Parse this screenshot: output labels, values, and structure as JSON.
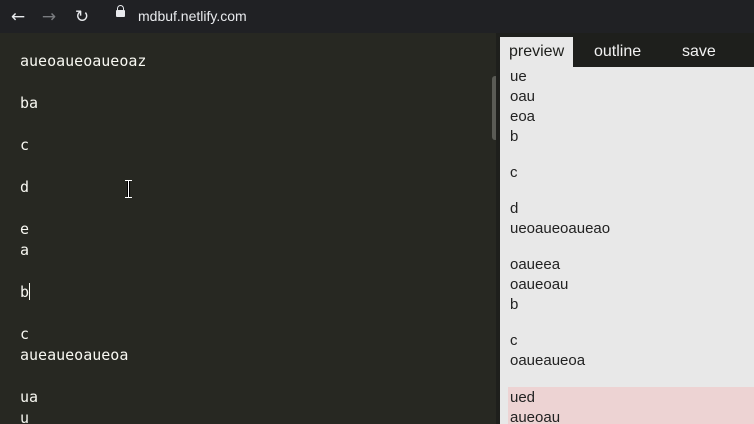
{
  "browser": {
    "url": "mdbuf.netlify.com",
    "icons": {
      "back": "arrow-left-icon",
      "forward": "arrow-right-icon",
      "reload": "reload-icon",
      "secure": "lock-icon"
    }
  },
  "editor": {
    "lines": [
      "aueoaueoaueoaz",
      "",
      "ba",
      "",
      "c",
      "",
      "d",
      "",
      "e",
      "a",
      "",
      "b",
      "",
      "c",
      "aueaueoaueoa",
      "",
      "ua",
      "u"
    ],
    "caret_line_index": 11
  },
  "panel": {
    "tabs": [
      {
        "label": "preview",
        "active": true
      },
      {
        "label": "outline",
        "active": false
      },
      {
        "label": "save",
        "active": false
      }
    ],
    "preview_blocks": [
      {
        "lines": [
          "ue",
          "oau",
          "eoa",
          "b"
        ]
      },
      {
        "lines": [
          "c"
        ]
      },
      {
        "lines": [
          "d",
          "ueoaueoaueao"
        ]
      },
      {
        "lines": [
          "oaueea",
          "oaueoau",
          "b"
        ]
      },
      {
        "lines": [
          "c",
          "oaueaueoa"
        ]
      },
      {
        "lines": [
          "ued",
          "aueoau"
        ],
        "highlighted": true
      }
    ]
  },
  "colors": {
    "editor_bg": "#272822",
    "editor_text": "#f8f8f2",
    "panel_bg": "#e8e8e8",
    "highlight_bg": "#edd3d3"
  }
}
